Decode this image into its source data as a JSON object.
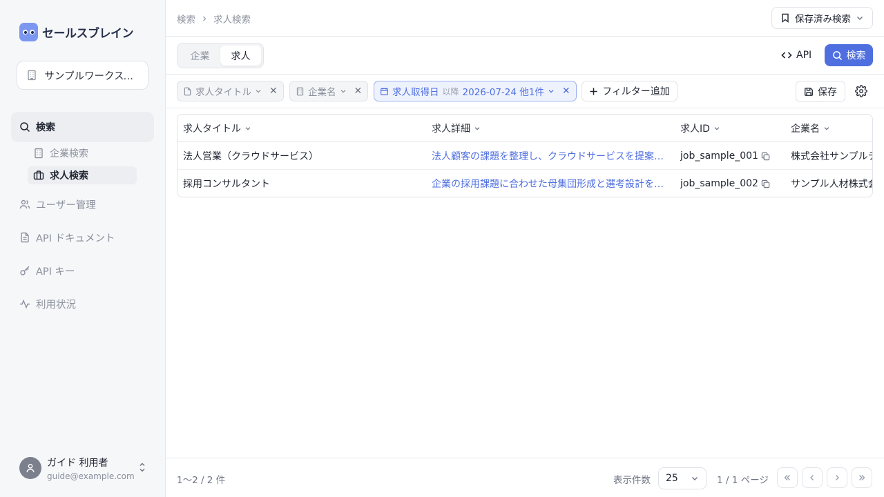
{
  "app": {
    "logo_text": "セールスブレイン"
  },
  "workspace": {
    "label": "サンプルワークスペ..."
  },
  "sidebar": {
    "search_label": "検索",
    "sub_items": [
      {
        "label": "企業検索"
      },
      {
        "label": "求人検索"
      }
    ],
    "items": [
      {
        "label": "ユーザー管理"
      },
      {
        "label": "API ドキュメント"
      },
      {
        "label": "API キー"
      },
      {
        "label": "利用状況"
      }
    ]
  },
  "user": {
    "name": "ガイド 利用者",
    "email": "guide@example.com"
  },
  "header": {
    "breadcrumb": [
      "検索",
      "求人検索"
    ],
    "saved_search_label": "保存済み検索"
  },
  "toolbar": {
    "tabs": [
      {
        "label": "企業"
      },
      {
        "label": "求人"
      }
    ],
    "api_label": "API",
    "search_label": "検索"
  },
  "filters": {
    "chips": [
      {
        "label": "求人タイトル"
      },
      {
        "label": "企業名"
      },
      {
        "label": "求人取得日",
        "operator": "以降",
        "value": "2026-07-24 他1件"
      }
    ],
    "add_label": "フィルター追加",
    "save_label": "保存"
  },
  "table": {
    "columns": [
      "求人タイトル",
      "求人詳細",
      "求人ID",
      "企業名"
    ],
    "rows": [
      [
        "法人営業（クラウドサービス）",
        "法人顧客の課題を整理し、クラウドサービスを提案…",
        "job_sample_001",
        "株式会社サンプルテ"
      ],
      [
        "採用コンサルタント",
        "企業の採用課題に合わせた母集団形成と選考設計を…",
        "job_sample_002",
        "サンプル人材株式会"
      ]
    ]
  },
  "footer": {
    "count": "1〜2 / 2 件",
    "per_page_label": "表示件数",
    "per_page_value": "25",
    "page_info": "1 / 1 ページ"
  },
  "colors": {
    "accent": "#4f6fe0",
    "sidebar_bg": "#f6f7f9"
  }
}
